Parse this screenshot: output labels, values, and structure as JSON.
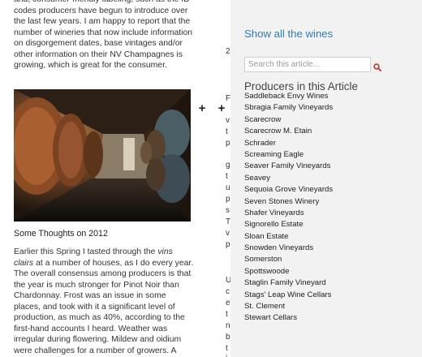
{
  "article": {
    "paragraph_top": "and, consumer-friendly labeling, such as the ID codes producers have begun to introduce over the last few years. I am happy to report that the number of wineries that now include information on disgorgement dates, base vintages and/or other information on their NV Champagnes is growing, which is great for the consumer.",
    "section_heading": "Some Thoughts on 2012",
    "paragraph_bottom": {
      "pre": "Earlier this Spring I tasted through the ",
      "em": "vins clairs",
      "post": " at a number of houses, as I do every year. The overall consensus among producers is that the year is much stronger for Pinot Noir than Chardonnay. Frost was an issue in some places, and took with it a significant level of production, as much as 40%, according to the first-hand accounts I heard. Weather was irregular during flowering. Mildew and oidium were challenges for a number of growers. A"
    },
    "plus_buttons": [
      "+",
      "+"
    ],
    "second_column_fragments": [
      "2",
      "F",
      "v",
      "t",
      "p",
      "g",
      "t",
      "u",
      "p",
      "s",
      "T",
      "v",
      "p",
      "U",
      "c",
      "e",
      "t",
      "n",
      "b",
      "t",
      "i"
    ]
  },
  "sidebar": {
    "show_wines_label": "Show all the wines",
    "search_placeholder": "Search this article...",
    "producers_heading": "Producers in this Article",
    "producers": [
      "Saddleback Envy Wines",
      "Sbragia Family Vineyards",
      "Scarecrow",
      "Scarecrow M. Etain",
      "Schrader",
      "Screaming Eagle",
      "Seaver Family Vineyards",
      "Seavey",
      "Sequoia Grove Vineyards",
      "Seven Stones Winery",
      "Shafer Vineyards",
      "Signorello Estate",
      "Sloan Estate",
      "Snowden Vineyards",
      "Somerston",
      "Spottswoode",
      "Staglin Family Vineyard",
      "Stags' Leap Wine Cellars",
      "St. Clement",
      "Stewart Cellars"
    ]
  },
  "colors": {
    "link_blue": "#2e7db4",
    "search_icon_red": "#c0392b",
    "sidebar_bg": "#f2f2f2"
  }
}
